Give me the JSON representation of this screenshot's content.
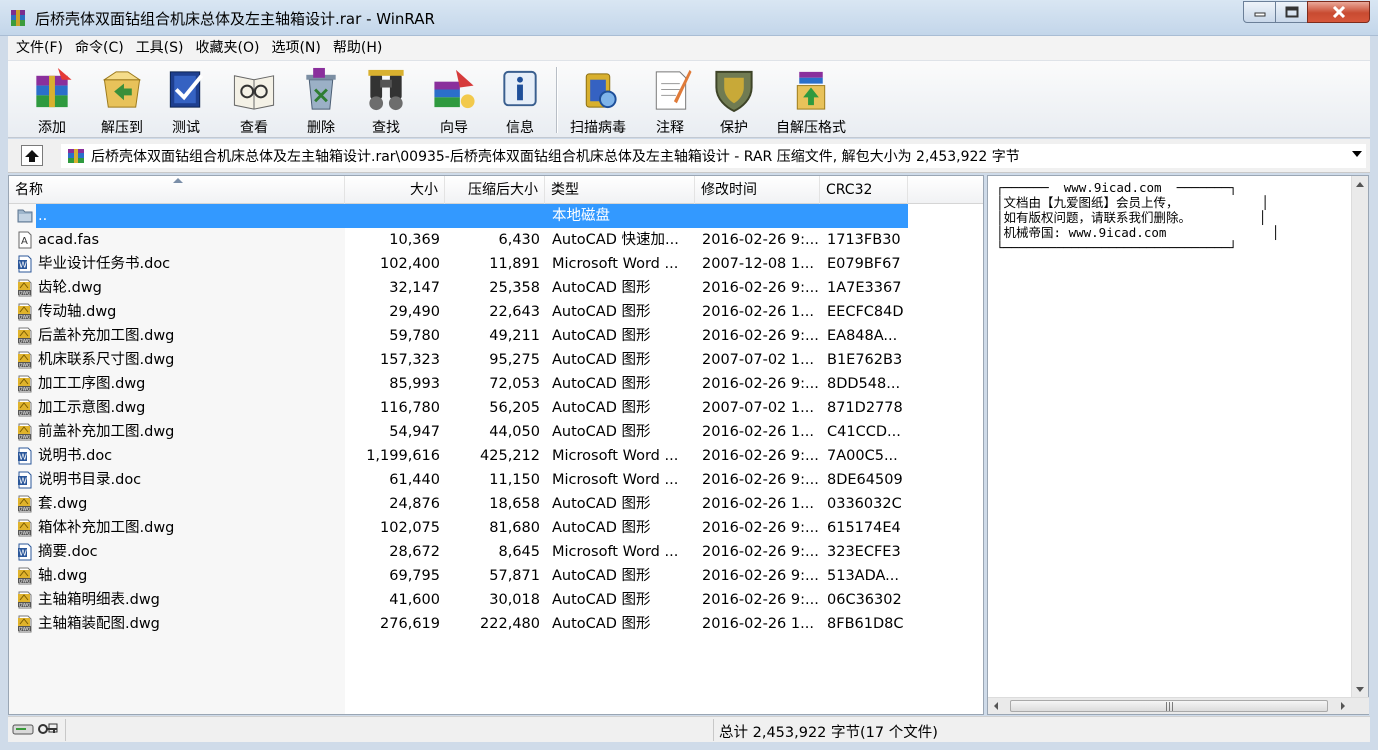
{
  "window": {
    "title": "后桥壳体双面钻组合机床总体及左主轴箱设计.rar - WinRAR"
  },
  "menu": [
    "文件(F)",
    "命令(C)",
    "工具(S)",
    "收藏夹(O)",
    "选项(N)",
    "帮助(H)"
  ],
  "toolbar": [
    {
      "label": "添加",
      "icon": "add-archive-icon"
    },
    {
      "label": "解压到",
      "icon": "extract-to-icon"
    },
    {
      "label": "测试",
      "icon": "test-icon"
    },
    {
      "label": "查看",
      "icon": "view-icon"
    },
    {
      "label": "删除",
      "icon": "delete-icon"
    },
    {
      "label": "查找",
      "icon": "find-icon"
    },
    {
      "label": "向导",
      "icon": "wizard-icon"
    },
    {
      "label": "信息",
      "icon": "info-icon"
    },
    {
      "label": "扫描病毒",
      "icon": "virus-scan-icon"
    },
    {
      "label": "注释",
      "icon": "comment-icon"
    },
    {
      "label": "保护",
      "icon": "protect-icon"
    },
    {
      "label": "自解压格式",
      "icon": "sfx-icon"
    }
  ],
  "address": {
    "path": "后桥壳体双面钻组合机床总体及左主轴箱设计.rar\\00935-后桥壳体双面钻组合机床总体及左主轴箱设计 - RAR 压缩文件, 解包大小为 2,453,922 字节"
  },
  "columns": {
    "name": "名称",
    "size": "大小",
    "packed": "压缩后大小",
    "type": "类型",
    "modified": "修改时间",
    "crc": "CRC32"
  },
  "files": [
    {
      "icon": "folder-up-icon",
      "name": "..",
      "size": "",
      "packed": "",
      "type": "本地磁盘",
      "modified": "",
      "crc": "",
      "selected": true
    },
    {
      "icon": "fas-file-icon",
      "name": "acad.fas",
      "size": "10,369",
      "packed": "6,430",
      "type": "AutoCAD 快速加...",
      "modified": "2016-02-26 9:...",
      "crc": "1713FB30"
    },
    {
      "icon": "word-doc-icon",
      "name": "毕业设计任务书.doc",
      "size": "102,400",
      "packed": "11,891",
      "type": "Microsoft Word ...",
      "modified": "2007-12-08 1...",
      "crc": "E079BF67"
    },
    {
      "icon": "dwg-file-icon",
      "name": "齿轮.dwg",
      "size": "32,147",
      "packed": "25,358",
      "type": "AutoCAD 图形",
      "modified": "2016-02-26 9:...",
      "crc": "1A7E3367"
    },
    {
      "icon": "dwg-file-icon",
      "name": "传动轴.dwg",
      "size": "29,490",
      "packed": "22,643",
      "type": "AutoCAD 图形",
      "modified": "2016-02-26 1...",
      "crc": "EECFC84D"
    },
    {
      "icon": "dwg-file-icon",
      "name": "后盖补充加工图.dwg",
      "size": "59,780",
      "packed": "49,211",
      "type": "AutoCAD 图形",
      "modified": "2016-02-26 9:...",
      "crc": "EA848A..."
    },
    {
      "icon": "dwg-file-icon",
      "name": "机床联系尺寸图.dwg",
      "size": "157,323",
      "packed": "95,275",
      "type": "AutoCAD 图形",
      "modified": "2007-07-02 1...",
      "crc": "B1E762B3"
    },
    {
      "icon": "dwg-file-icon",
      "name": "加工工序图.dwg",
      "size": "85,993",
      "packed": "72,053",
      "type": "AutoCAD 图形",
      "modified": "2016-02-26 9:...",
      "crc": "8DD548..."
    },
    {
      "icon": "dwg-file-icon",
      "name": "加工示意图.dwg",
      "size": "116,780",
      "packed": "56,205",
      "type": "AutoCAD 图形",
      "modified": "2007-07-02 1...",
      "crc": "871D2778"
    },
    {
      "icon": "dwg-file-icon",
      "name": "前盖补充加工图.dwg",
      "size": "54,947",
      "packed": "44,050",
      "type": "AutoCAD 图形",
      "modified": "2016-02-26 1...",
      "crc": "C41CCD..."
    },
    {
      "icon": "word-doc-icon",
      "name": "说明书.doc",
      "size": "1,199,616",
      "packed": "425,212",
      "type": "Microsoft Word ...",
      "modified": "2016-02-26 9:...",
      "crc": "7A00C5..."
    },
    {
      "icon": "word-doc-icon",
      "name": "说明书目录.doc",
      "size": "61,440",
      "packed": "11,150",
      "type": "Microsoft Word ...",
      "modified": "2016-02-26 9:...",
      "crc": "8DE64509"
    },
    {
      "icon": "dwg-file-icon",
      "name": "套.dwg",
      "size": "24,876",
      "packed": "18,658",
      "type": "AutoCAD 图形",
      "modified": "2016-02-26 1...",
      "crc": "0336032C"
    },
    {
      "icon": "dwg-file-icon",
      "name": "箱体补充加工图.dwg",
      "size": "102,075",
      "packed": "81,680",
      "type": "AutoCAD 图形",
      "modified": "2016-02-26 9:...",
      "crc": "615174E4"
    },
    {
      "icon": "word-doc-icon",
      "name": "摘要.doc",
      "size": "28,672",
      "packed": "8,645",
      "type": "Microsoft Word ...",
      "modified": "2016-02-26 9:...",
      "crc": "323ECFE3"
    },
    {
      "icon": "dwg-file-icon",
      "name": "轴.dwg",
      "size": "69,795",
      "packed": "57,871",
      "type": "AutoCAD 图形",
      "modified": "2016-02-26 9:...",
      "crc": "513ADA..."
    },
    {
      "icon": "dwg-file-icon",
      "name": "主轴箱明细表.dwg",
      "size": "41,600",
      "packed": "30,018",
      "type": "AutoCAD 图形",
      "modified": "2016-02-26 9:...",
      "crc": "06C36302"
    },
    {
      "icon": "dwg-file-icon",
      "name": "主轴箱装配图.dwg",
      "size": "276,619",
      "packed": "222,480",
      "type": "AutoCAD 图形",
      "modified": "2016-02-26 1...",
      "crc": "8FB61D8C"
    }
  ],
  "comment": {
    "text": "┌──────  www.9icad.com  ───────┐\n│文档由【九爱图纸】会员上传，           │\n│如有版权问题，请联系我们删除。         │\n│机械帝国: www.9icad.com              │\n└──────────────────────────────┘"
  },
  "status": {
    "total": "总计 2,453,922 字节(17 个文件)"
  },
  "colors": {
    "selection": "#3399ff",
    "titlebar": "#c3d6ea",
    "close_button": "#c84b31"
  }
}
